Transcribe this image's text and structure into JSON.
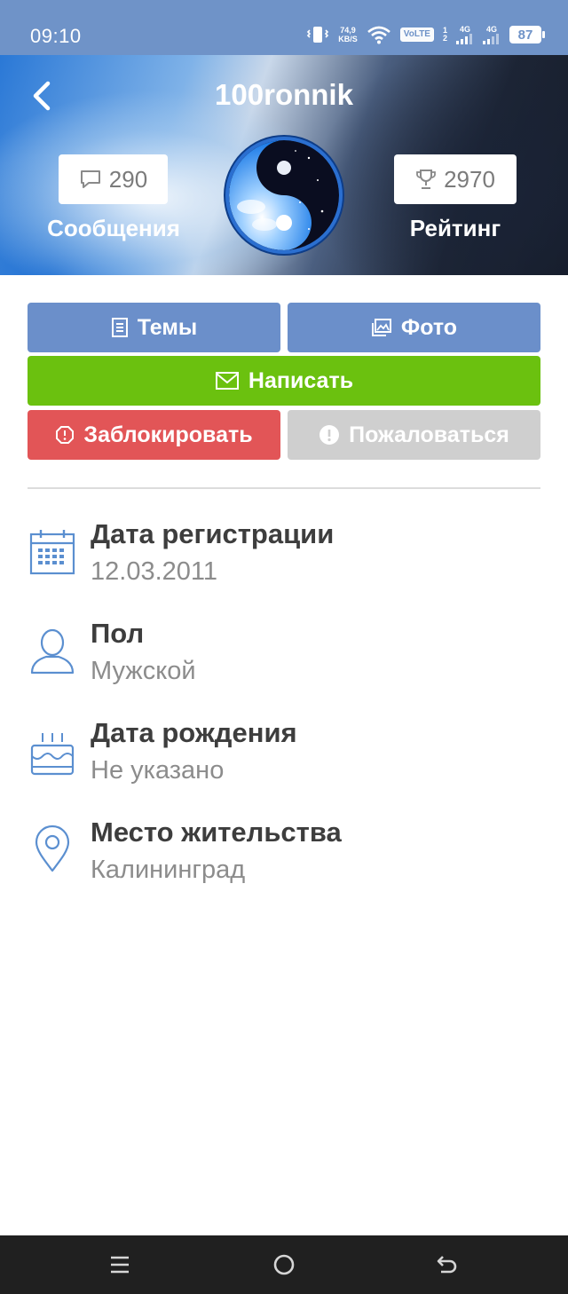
{
  "status_bar": {
    "time": "09:10",
    "net_speed_value": "74,9",
    "net_speed_unit": "KB/S",
    "volte": "VoLTE",
    "sim1": "1",
    "sim2": "2",
    "network1": "4G",
    "network2": "4G",
    "battery": "87",
    "icons": [
      "vibrate-icon",
      "wifi-icon",
      "signal-icon",
      "battery-icon"
    ]
  },
  "profile": {
    "username": "100ronnik",
    "messages_count": "290",
    "messages_label": "Сообщения",
    "rating_count": "2970",
    "rating_label": "Рейтинг"
  },
  "actions": {
    "topics": "Темы",
    "photo": "Фото",
    "write": "Написать",
    "block": "Заблокировать",
    "report": "Пожаловаться"
  },
  "colors": {
    "accent_blue": "#6b8fca",
    "green": "#6bc10f",
    "red": "#e25557",
    "disabled_gray": "#cfcfcf",
    "status_bar": "#6f93c8",
    "icon_blue": "#5b8fd0"
  },
  "info": [
    {
      "icon": "calendar-icon",
      "title": "Дата регистрации",
      "value": "12.03.2011"
    },
    {
      "icon": "person-icon",
      "title": "Пол",
      "value": "Мужской"
    },
    {
      "icon": "cake-icon",
      "title": "Дата рождения",
      "value": "Не указано"
    },
    {
      "icon": "location-pin-icon",
      "title": "Место жительства",
      "value": "Калининград"
    }
  ],
  "nav_bar": {
    "icons": [
      "menu-icon",
      "home-icon",
      "back-icon"
    ]
  }
}
